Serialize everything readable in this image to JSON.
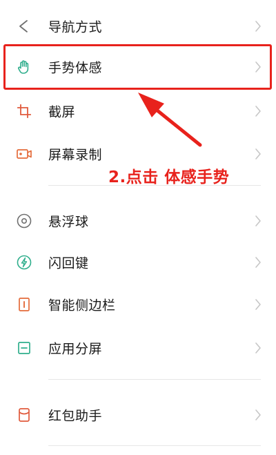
{
  "menu": {
    "items": [
      {
        "label": "导航方式",
        "icon": "navigation-back-icon"
      },
      {
        "label": "手势体感",
        "icon": "hand-gesture-icon"
      },
      {
        "label": "截屏",
        "icon": "crop-screenshot-icon"
      },
      {
        "label": "屏幕录制",
        "icon": "screen-record-icon"
      },
      {
        "label": "悬浮球",
        "icon": "floating-ball-icon"
      },
      {
        "label": "闪回键",
        "icon": "flashback-key-icon"
      },
      {
        "label": "智能侧边栏",
        "icon": "smart-sidebar-icon"
      },
      {
        "label": "应用分屏",
        "icon": "split-screen-icon"
      },
      {
        "label": "红包助手",
        "icon": "red-envelope-icon"
      }
    ]
  },
  "annotation": {
    "text": "2.点击 体感手势"
  },
  "colors": {
    "icon_gray": "#6f6f6f",
    "icon_green": "#2fae8c",
    "icon_red": "#e05a3c",
    "icon_orange": "#e46b3a",
    "chevron": "#c6c6c6",
    "highlight_red": "#e8221c"
  }
}
